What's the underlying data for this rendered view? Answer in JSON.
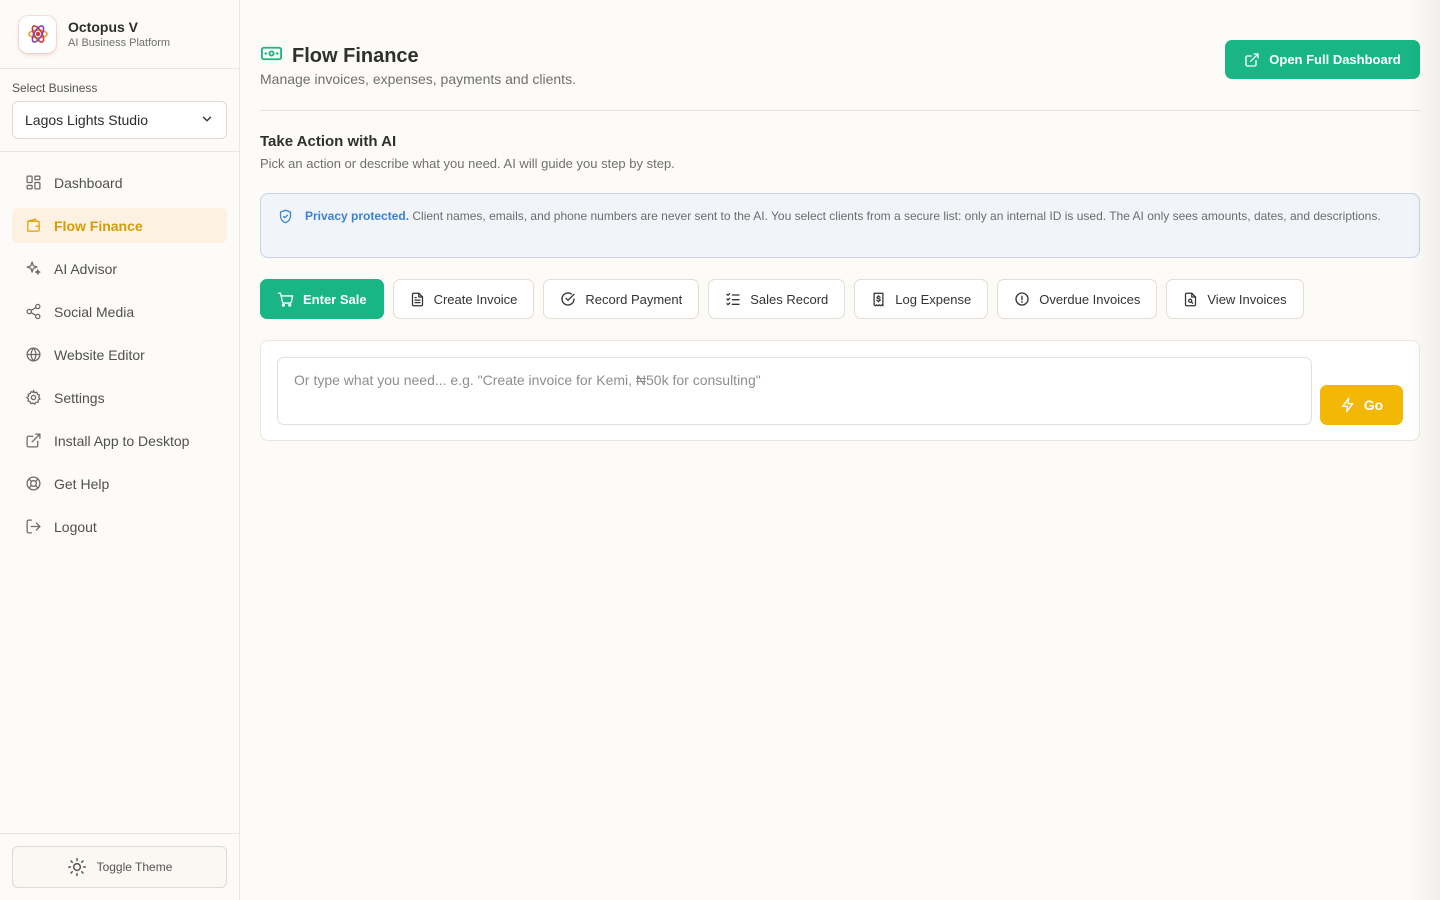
{
  "brand": {
    "name": "Octopus V",
    "subtitle": "AI Business Platform"
  },
  "business": {
    "label": "Select Business",
    "selected": "Lagos Lights Studio"
  },
  "nav": [
    {
      "label": "Dashboard",
      "icon": "grid-icon",
      "active": false
    },
    {
      "label": "Flow Finance",
      "icon": "wallet-icon",
      "active": true
    },
    {
      "label": "AI Advisor",
      "icon": "sparkles-icon",
      "active": false
    },
    {
      "label": "Social Media",
      "icon": "share-icon",
      "active": false
    },
    {
      "label": "Website Editor",
      "icon": "globe-icon",
      "active": false
    },
    {
      "label": "Settings",
      "icon": "gear-icon",
      "active": false
    },
    {
      "label": "Install App to Desktop",
      "icon": "external-link-icon",
      "active": false
    },
    {
      "label": "Get Help",
      "icon": "lifebuoy-icon",
      "active": false
    },
    {
      "label": "Logout",
      "icon": "logout-icon",
      "active": false
    }
  ],
  "theme_toggle": "Toggle Theme",
  "header": {
    "title": "Flow Finance",
    "subtitle": "Manage invoices, expenses, payments and clients.",
    "open_dashboard": "Open Full Dashboard"
  },
  "ai_section": {
    "title": "Take Action with AI",
    "subtitle": "Pick an action or describe what you need. AI will guide you step by step."
  },
  "privacy": {
    "strong": "Privacy protected.",
    "text": " Client names, emails, and phone numbers are never sent to the AI. You select clients from a secure list: only an internal ID is used. The AI only sees amounts, dates, and descriptions."
  },
  "actions": [
    {
      "label": "Enter Sale",
      "icon": "cart-icon",
      "primary": true
    },
    {
      "label": "Create Invoice",
      "icon": "document-icon",
      "primary": false
    },
    {
      "label": "Record Payment",
      "icon": "check-circle-icon",
      "primary": false
    },
    {
      "label": "Sales Record",
      "icon": "list-check-icon",
      "primary": false
    },
    {
      "label": "Log Expense",
      "icon": "receipt-icon",
      "primary": false
    },
    {
      "label": "Overdue Invoices",
      "icon": "alert-circle-icon",
      "primary": false
    },
    {
      "label": "View Invoices",
      "icon": "file-search-icon",
      "primary": false
    }
  ],
  "prompt": {
    "placeholder": "Or type what you need... e.g. \"Create invoice for Kemi, ₦50k for consulting\"",
    "go_label": "Go"
  },
  "colors": {
    "accent_green": "#19b584",
    "accent_amber": "#f3b705",
    "active_nav": "#d69b06",
    "privacy_blue": "#3b82d6"
  }
}
